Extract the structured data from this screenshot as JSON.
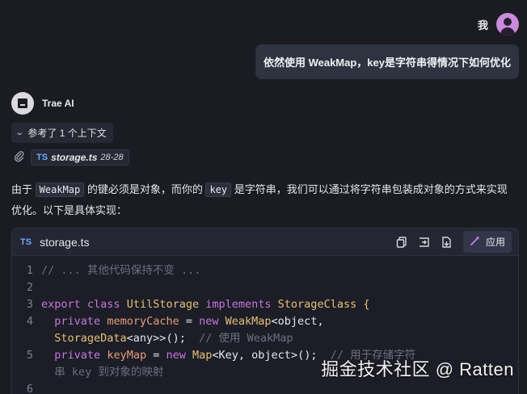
{
  "user": {
    "name": "我",
    "message": "依然使用 WeakMap，key是字符串得情况下如何优化"
  },
  "assistant": {
    "name": "Trae AI"
  },
  "context_toggle": {
    "label": "参考了 1 个上下文"
  },
  "file_ref": {
    "badge": "TS",
    "filename": "storage.ts",
    "range": "28-28"
  },
  "explanation": {
    "part1": "由于 ",
    "code1": "WeakMap",
    "part2": " 的键必须是对象，而你的 ",
    "code2": "key",
    "part3": " 是字符串，我们可以通过将字符串包装成对象的方式来实现优化。以下是具体实现："
  },
  "code_block": {
    "badge": "TS",
    "filename": "storage.ts",
    "apply_label": "应用",
    "lines": [
      {
        "num": "1",
        "comment": "// ... 其他代码保持不变 ..."
      },
      {
        "num": "2"
      },
      {
        "num": "3",
        "kw1": "export",
        "kw2": "class",
        "name": "UtilStorage",
        "kw3": "implements",
        "iface": "StorageClass",
        "brace": "{"
      },
      {
        "num": "4",
        "kw": "private",
        "prop": "memoryCache",
        "eq": " = ",
        "kw_new": "new",
        "type": "WeakMap",
        "generic": "<object,",
        "cont": "StorageData",
        "cont2": "<any>>();",
        "comment": "// 使用 WeakMap"
      },
      {
        "num": "5",
        "kw": "private",
        "prop": "keyMap",
        "eq": " = ",
        "kw_new": "new",
        "type": "Map",
        "generic": "<Key, object>();",
        "comment": "// 用于存储字符",
        "cont_comment": "串 key 到对象的映射"
      },
      {
        "num": "6"
      }
    ]
  },
  "watermark": "掘金技术社区 @ Ratten"
}
